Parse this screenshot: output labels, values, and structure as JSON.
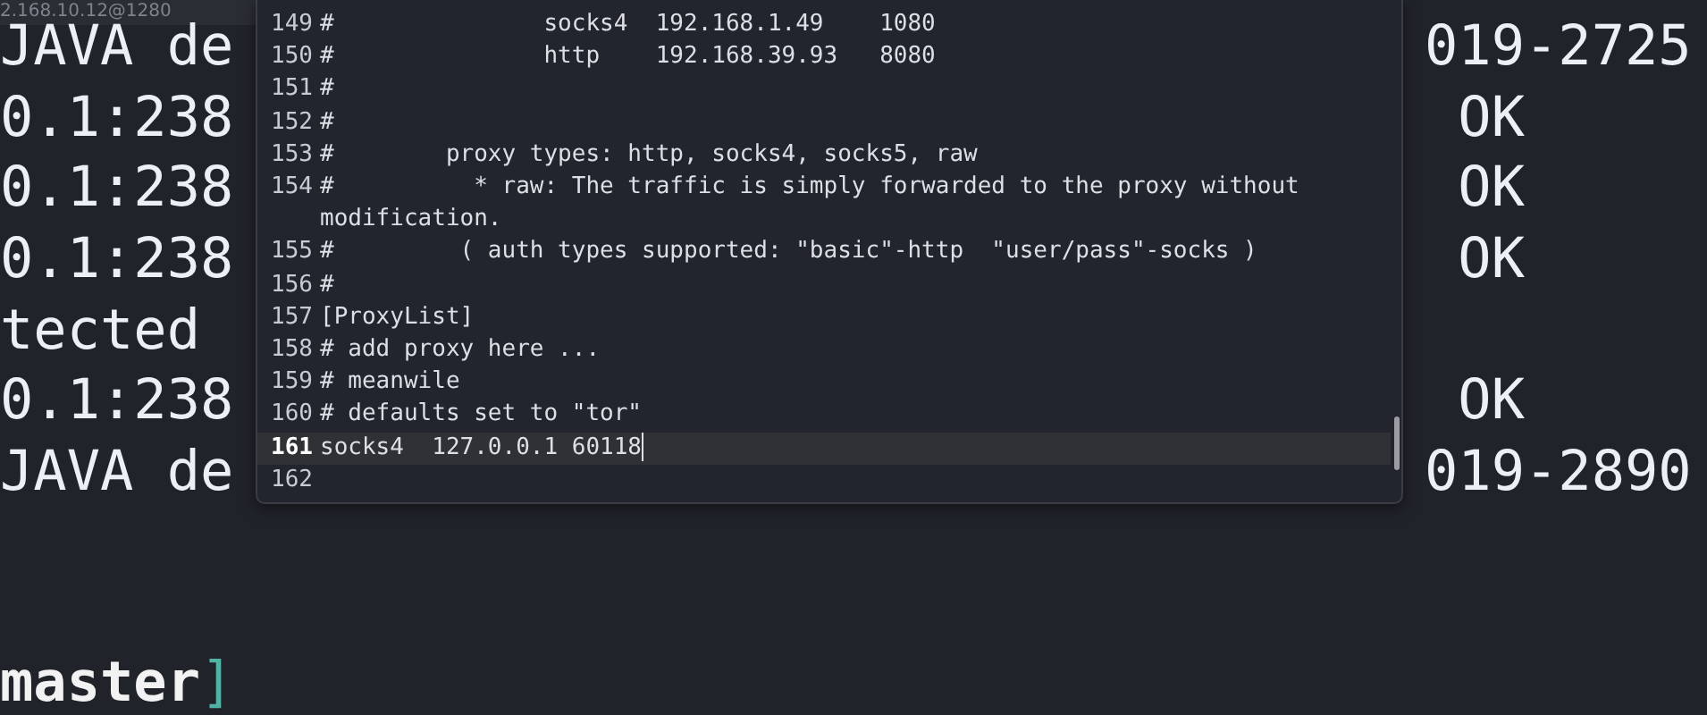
{
  "terminal": {
    "tab_title": "2.168.10.12@1280",
    "rows": [
      {
        "left": "JAVA de",
        "right": "019-2725"
      },
      {
        "left": "0.1:238",
        "right": " OK"
      },
      {
        "left": "0.1:238",
        "right": " OK"
      },
      {
        "left": "0.1:238",
        "right": " OK"
      },
      {
        "left": "tected"
      },
      {
        "left": "0.1:238",
        "right": " OK"
      },
      {
        "left": "JAVA de",
        "right": "019-2890"
      }
    ],
    "prompt": {
      "branch": "master",
      "bracket": "]"
    }
  },
  "editor": {
    "lines": [
      {
        "number": "149",
        "text": "#               socks4  192.168.1.49    1080",
        "current": false
      },
      {
        "number": "150",
        "text": "#               http    192.168.39.93   8080",
        "current": false
      },
      {
        "number": "151",
        "text": "#",
        "current": false
      },
      {
        "number": "152",
        "text": "#",
        "current": false
      },
      {
        "number": "153",
        "text": "#        proxy types: http, socks4, socks5, raw",
        "current": false
      },
      {
        "number": "154",
        "text": "#          * raw: The traffic is simply forwarded to the proxy without modification.",
        "current": false
      },
      {
        "number": "155",
        "text": "#         ( auth types supported: \"basic\"-http  \"user/pass\"-socks )",
        "current": false
      },
      {
        "number": "156",
        "text": "#",
        "current": false
      },
      {
        "number": "157",
        "text": "[ProxyList]",
        "current": false
      },
      {
        "number": "158",
        "text": "# add proxy here ...",
        "current": false
      },
      {
        "number": "159",
        "text": "# meanwile",
        "current": false
      },
      {
        "number": "160",
        "text": "# defaults set to \"tor\"",
        "current": false
      },
      {
        "number": "161",
        "text": "socks4  127.0.0.1 60118",
        "current": true
      },
      {
        "number": "162",
        "current": false
      }
    ]
  }
}
